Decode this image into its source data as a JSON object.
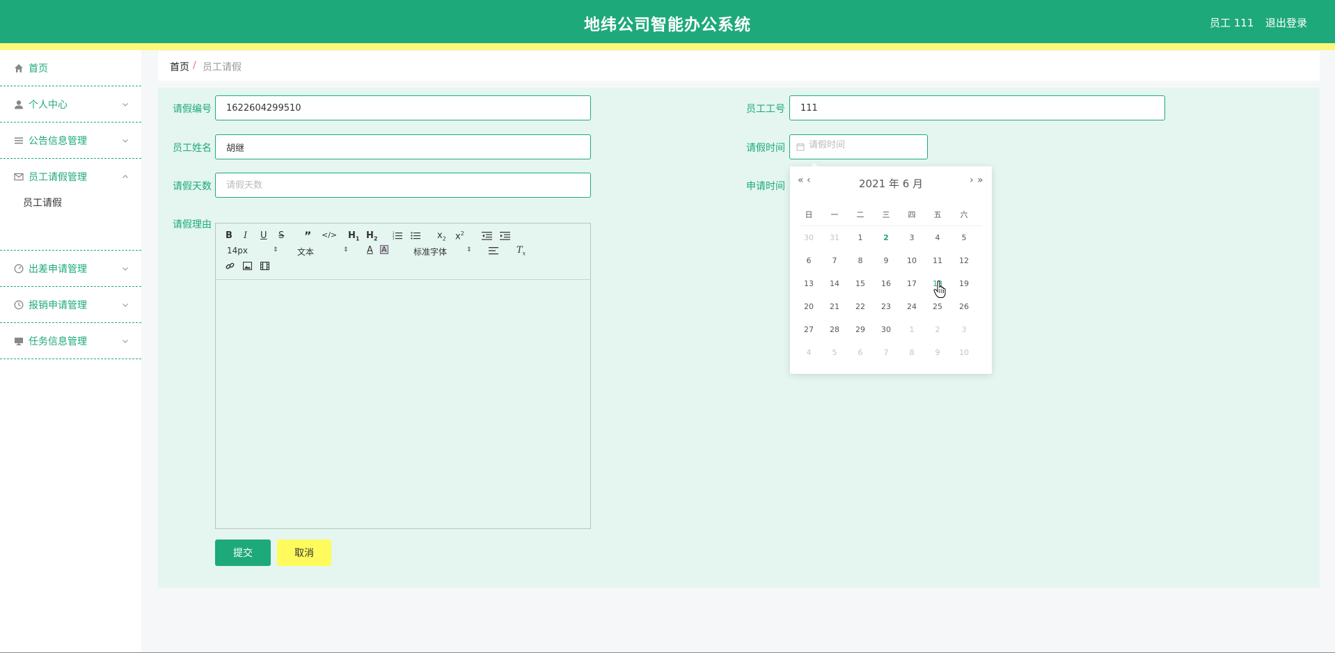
{
  "header": {
    "title": "地纬公司智能办公系统",
    "user_label": "员工 111",
    "logout_label": "退出登录",
    "bg_color": "#1ea97b",
    "accent_bar_color": "#fdf77a"
  },
  "sidebar": {
    "items": [
      {
        "label": "首页",
        "icon": "home-icon"
      },
      {
        "label": "个人中心",
        "icon": "user-icon"
      },
      {
        "label": "公告信息管理",
        "icon": "list-icon"
      },
      {
        "label": "员工请假管理",
        "icon": "mail-icon",
        "expanded": true
      },
      {
        "label": "出差申请管理",
        "icon": "gauge-icon"
      },
      {
        "label": "报销申请管理",
        "icon": "clock-icon"
      },
      {
        "label": "任务信息管理",
        "icon": "monitor-icon"
      }
    ],
    "sub_items": [
      {
        "label": "员工请假"
      }
    ]
  },
  "breadcrumb": {
    "home": "首页",
    "separator": "/",
    "current": "员工请假"
  },
  "form": {
    "leave_no": {
      "label": "请假编号",
      "value": "1622604299510"
    },
    "employee_no": {
      "label": "员工工号",
      "value": "111"
    },
    "employee_name": {
      "label": "员工姓名",
      "value": "胡继"
    },
    "leave_time": {
      "label": "请假时间",
      "placeholder": "请假时间"
    },
    "leave_days": {
      "label": "请假天数",
      "placeholder": "请假天数"
    },
    "apply_time": {
      "label": "申请时间"
    },
    "reason": {
      "label": "请假理由"
    },
    "editor": {
      "font_size": "14px",
      "format": "文本",
      "font_family": "标准字体"
    },
    "submit_label": "提交",
    "cancel_label": "取消"
  },
  "datepicker": {
    "header": "2021 年  6 月",
    "prev_year": "«",
    "prev_month": "‹",
    "next_month": "›",
    "next_year": "»",
    "weekdays": [
      "日",
      "一",
      "二",
      "三",
      "四",
      "五",
      "六"
    ],
    "weeks": [
      [
        {
          "d": "30",
          "t": "other"
        },
        {
          "d": "31",
          "t": "other"
        },
        {
          "d": "1",
          "t": "cur"
        },
        {
          "d": "2",
          "t": "today"
        },
        {
          "d": "3",
          "t": "cur"
        },
        {
          "d": "4",
          "t": "cur"
        },
        {
          "d": "5",
          "t": "cur"
        }
      ],
      [
        {
          "d": "6",
          "t": "cur"
        },
        {
          "d": "7",
          "t": "cur"
        },
        {
          "d": "8",
          "t": "cur"
        },
        {
          "d": "9",
          "t": "cur"
        },
        {
          "d": "10",
          "t": "cur"
        },
        {
          "d": "11",
          "t": "cur"
        },
        {
          "d": "12",
          "t": "cur"
        }
      ],
      [
        {
          "d": "13",
          "t": "cur"
        },
        {
          "d": "14",
          "t": "cur"
        },
        {
          "d": "15",
          "t": "cur"
        },
        {
          "d": "16",
          "t": "cur"
        },
        {
          "d": "17",
          "t": "cur"
        },
        {
          "d": "18",
          "t": "hover"
        },
        {
          "d": "19",
          "t": "cur"
        }
      ],
      [
        {
          "d": "20",
          "t": "cur"
        },
        {
          "d": "21",
          "t": "cur"
        },
        {
          "d": "22",
          "t": "cur"
        },
        {
          "d": "23",
          "t": "cur"
        },
        {
          "d": "24",
          "t": "cur"
        },
        {
          "d": "25",
          "t": "cur"
        },
        {
          "d": "26",
          "t": "cur"
        }
      ],
      [
        {
          "d": "27",
          "t": "cur"
        },
        {
          "d": "28",
          "t": "cur"
        },
        {
          "d": "29",
          "t": "cur"
        },
        {
          "d": "30",
          "t": "cur"
        },
        {
          "d": "1",
          "t": "other"
        },
        {
          "d": "2",
          "t": "other"
        },
        {
          "d": "3",
          "t": "other"
        }
      ],
      [
        {
          "d": "4",
          "t": "other"
        },
        {
          "d": "5",
          "t": "other"
        },
        {
          "d": "6",
          "t": "other"
        },
        {
          "d": "7",
          "t": "other"
        },
        {
          "d": "8",
          "t": "other"
        },
        {
          "d": "9",
          "t": "other"
        },
        {
          "d": "10",
          "t": "other"
        }
      ]
    ]
  }
}
